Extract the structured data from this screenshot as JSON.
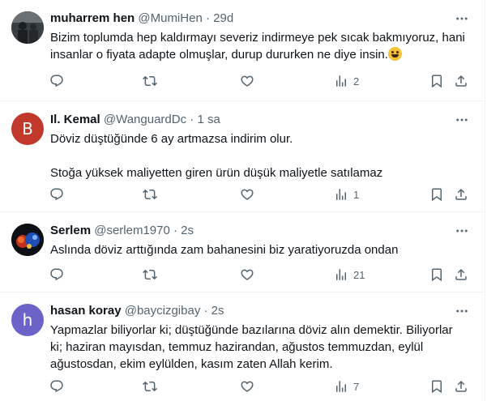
{
  "colors": {
    "text": "#0f1419",
    "secondary": "#536471",
    "divider": "#eff3f4"
  },
  "tweets": [
    {
      "name": "muharrem hen",
      "handle": "@MumiHen",
      "dot": "·",
      "time": "29d",
      "avatar_icon": "user-photo",
      "lines": [
        "Bizim toplumda hep kaldırmayı severiz indirmeye pek sıcak bakmıyoruz, hani insanlar o fiyata adapte olmuşlar, durup dururken ne diye insin."
      ],
      "emoji": "grinning-face-emoji",
      "views": "2"
    },
    {
      "name": "Il. Kemal",
      "handle": "@WanguardDc",
      "dot": "·",
      "time": "1 sa",
      "avatar_letter": "B",
      "lines": [
        "Döviz düştüğünde 6 ay artmazsa indirim olur.",
        "Stoğa yüksek maliyetten giren ürün düşük maliyetle satılamaz"
      ],
      "views": "1"
    },
    {
      "name": "Serlem",
      "handle": "@serlem1970",
      "dot": "·",
      "time": "2s",
      "avatar_icon": "user-photo",
      "lines": [
        "Aslında döviz arttığında zam bahanesini biz yaratiyoruzda ondan"
      ],
      "views": "21"
    },
    {
      "name": "hasan koray",
      "handle": "@baycizgibay",
      "dot": "·",
      "time": "2s",
      "avatar_letter": "h",
      "lines": [
        "Yapmazlar biliyorlar ki; düştüğünde bazılarına döviz alın demektir. Biliyorlar ki; haziran mayısdan, temmuz hazirandan, ağustos temmuzdan, eylül ağustosdan, ekim eylülden, kasım zaten Allah kerim."
      ],
      "views": "7"
    }
  ]
}
